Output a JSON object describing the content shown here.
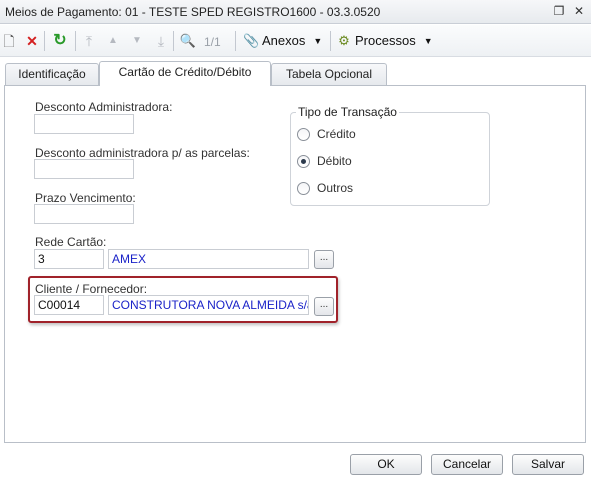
{
  "window": {
    "title": "Meios de Pagamento: 01 - TESTE SPED REGISTRO1600 - 03.3.0520",
    "restore_glyph": "❐",
    "close_glyph": "✕"
  },
  "toolbar": {
    "new_icon": "new-document-icon",
    "new_glyph": "🗋",
    "delete_icon": "delete-icon",
    "delete_glyph": "✕",
    "refresh_icon": "refresh-icon",
    "refresh_glyph": "↻",
    "first_glyph": "⤒",
    "prev_glyph": "▲",
    "next_glyph": "▼",
    "last_glyph": "⤓",
    "search_glyph": "🔍",
    "pager": "1/1",
    "attachments_label": "Anexos",
    "attachments_glyph": "📎",
    "processes_label": "Processos",
    "processes_glyph": "⚙",
    "caret_glyph": "▼"
  },
  "tabs": [
    {
      "label": "Identificação",
      "active": false
    },
    {
      "label": "Cartão de Crédito/Débito",
      "active": true
    },
    {
      "label": "Tabela Opcional",
      "active": false
    }
  ],
  "form": {
    "desconto_admin": {
      "label": "Desconto Administradora:",
      "value": ""
    },
    "desconto_parcelas": {
      "label": "Desconto administradora p/ as parcelas:",
      "value": ""
    },
    "prazo_vencimento": {
      "label": "Prazo Vencimento:",
      "value": ""
    },
    "rede_cartao": {
      "label": "Rede Cartão:",
      "code": "3",
      "description": "AMEX"
    },
    "cliente_fornecedor": {
      "label": "Cliente / Fornecedor:",
      "code": "C00014",
      "description": "CONSTRUTORA NOVA ALMEIDA s/a"
    },
    "lookup_label": "..."
  },
  "tipo_transacao": {
    "legend": "Tipo de Transação",
    "options": [
      {
        "label": "Crédito",
        "checked": false
      },
      {
        "label": "Débito",
        "checked": true
      },
      {
        "label": "Outros",
        "checked": false
      }
    ]
  },
  "buttons": {
    "ok": "OK",
    "cancel": "Cancelar",
    "save": "Salvar"
  },
  "colors": {
    "highlight_border": "#a0222a",
    "link_text": "#1a22c8",
    "delete_icon": "#d42020",
    "refresh_icon": "#2a9a2a"
  }
}
